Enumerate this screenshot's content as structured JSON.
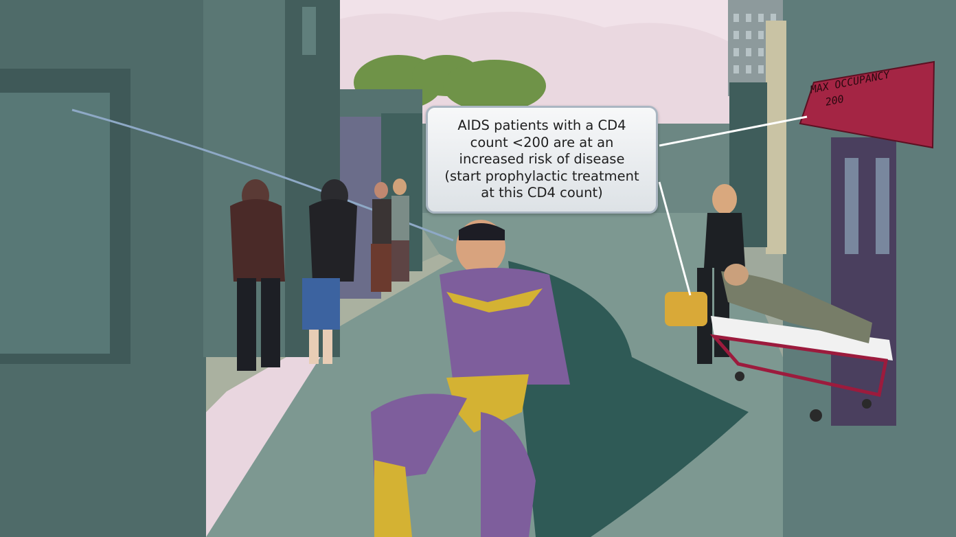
{
  "callout": {
    "lines": [
      "AIDS patients with a CD4",
      "count <200 are at an",
      "increased risk of disease",
      "(start prophylactic treatment",
      "at this CD4 count)"
    ]
  },
  "awning_sign": {
    "line1": "MAX OCCUPANCY",
    "line2": "200"
  },
  "colors": {
    "sky": "#ead8e0",
    "street": "#7d9891",
    "buildings": "#4f6b69",
    "hero_suit": "#7e5e9c",
    "hero_cape": "#2f5a56",
    "hero_trunks": "#d4b233",
    "awning": "#a42544",
    "callout_border": "#aab6c2",
    "paramedic_bag": "#d9a938"
  }
}
